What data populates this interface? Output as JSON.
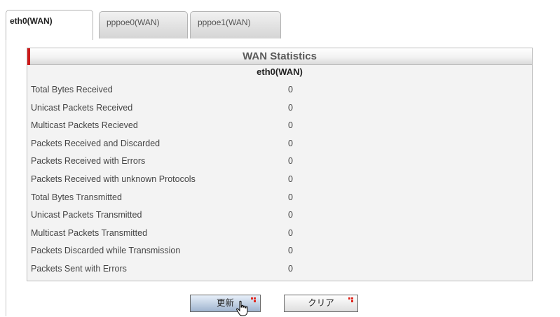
{
  "tabs": [
    {
      "label": "eth0(WAN)",
      "active": true
    },
    {
      "label": "pppoe0(WAN)",
      "active": false
    },
    {
      "label": "pppoe1(WAN)",
      "active": false
    }
  ],
  "stats": {
    "title": "WAN Statistics",
    "interface": "eth0(WAN)",
    "rows": [
      {
        "label": "Total Bytes Received",
        "value": "0"
      },
      {
        "label": "Unicast Packets Received",
        "value": "0"
      },
      {
        "label": "Multicast Packets Recieved",
        "value": "0"
      },
      {
        "label": "Packets Received and Discarded",
        "value": "0"
      },
      {
        "label": "Packets Received with Errors",
        "value": "0"
      },
      {
        "label": "Packets Received with unknown Protocols",
        "value": "0"
      },
      {
        "label": "Total Bytes Transmitted",
        "value": "0"
      },
      {
        "label": "Unicast Packets Transmitted",
        "value": "0"
      },
      {
        "label": "Multicast Packets Transmitted",
        "value": "0"
      },
      {
        "label": "Packets Discarded while Transmission",
        "value": "0"
      },
      {
        "label": "Packets Sent with Errors",
        "value": "0"
      }
    ]
  },
  "buttons": {
    "refresh_label": "更新",
    "clear_label": "クリア"
  },
  "colors": {
    "accent_red": "#cc1a1a",
    "refresh_button": "#9fb4cf"
  },
  "icons": {
    "button_marker": "red-dots-icon",
    "cursor": "hand-pointer-icon"
  }
}
